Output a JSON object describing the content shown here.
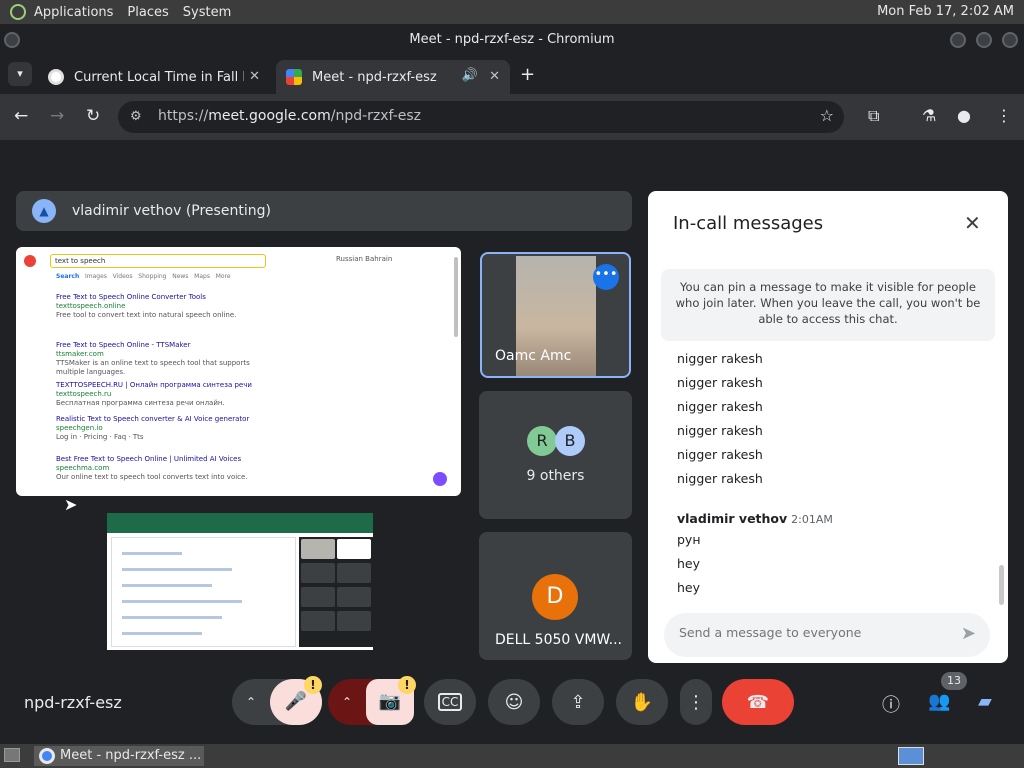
{
  "system": {
    "applications": "Applications",
    "places": "Places",
    "system_menu": "System",
    "clock": "Mon Feb 17,  2:02 AM"
  },
  "window": {
    "title": "Meet - npd-rzxf-esz - Chromium"
  },
  "tabs": [
    {
      "title": "Current Local Time in Fall Ri",
      "close": "✕"
    },
    {
      "title": "Meet - npd-rzxf-esz",
      "close": "✕"
    }
  ],
  "newtab": "+",
  "address": {
    "scheme": "https://",
    "host": "meet.google.com",
    "path": "/npd-rzxf-esz"
  },
  "presenting": {
    "text": "vladimir vethov (Presenting)"
  },
  "shared_screen": {
    "search_query": "text to speech",
    "top_right": "Russian Bahrain",
    "nav_tabs": [
      "Search",
      "Images",
      "Videos",
      "Shopping",
      "News",
      "Maps",
      "More"
    ],
    "results": [
      {
        "title": "Free Text to Speech Online Converter Tools",
        "url": "texttospeech.online",
        "desc": "Free tool to convert text into natural speech online."
      },
      {
        "title": "Free Text to Speech Online - TTSMaker",
        "url": "ttsmaker.com",
        "desc": "TTSMaker is an online text to speech tool that supports multiple languages."
      },
      {
        "title": "TEXTTOSPEECH.RU | Онлайн программа синтеза речи",
        "url": "texttospeech.ru",
        "desc": "Бесплатная программа синтеза речи онлайн."
      },
      {
        "title": "Realistic Text to Speech converter & AI Voice generator",
        "url": "speechgen.io",
        "desc": "Log in · Pricing · Faq · Tts"
      },
      {
        "title": "Best Free Text to Speech Online | Unlimited AI Voices",
        "url": "speechma.com",
        "desc": "Our online text to speech tool converts text into voice."
      }
    ]
  },
  "participants": {
    "oamc": {
      "name": "Оamc Amc",
      "more": "•••"
    },
    "others": {
      "label": "9 others",
      "avatar1": "R",
      "avatar2": "B"
    },
    "dell": {
      "name": "DELL 5050 VMW...",
      "initial": "D"
    }
  },
  "chat": {
    "title": "In-call messages",
    "close": "✕",
    "pin_info": "You can pin a message to make it visible for people who join later. When you leave the call, you won't be able to access this chat.",
    "messages_top": [
      "nigger rakesh",
      "nigger rakesh",
      "nigger rakesh",
      "nigger rakesh",
      "nigger rakesh",
      "nigger rakesh"
    ],
    "sender": "vladimir vethov",
    "sender_time": "2:01AM",
    "messages_bottom": [
      "рун",
      "hey",
      "hey"
    ],
    "input_placeholder": "Send a message to everyone"
  },
  "controls": {
    "meeting_code": "npd-rzxf-esz",
    "participants_count": "13",
    "warning": "!"
  },
  "taskbar": {
    "task": "Meet - npd-rzxf-esz ..."
  },
  "colors": {
    "end_call": "#ea4335",
    "mic_muted": "#f9dedc",
    "cam_off": "#f9dedc",
    "accent": "#8ab4f8"
  }
}
